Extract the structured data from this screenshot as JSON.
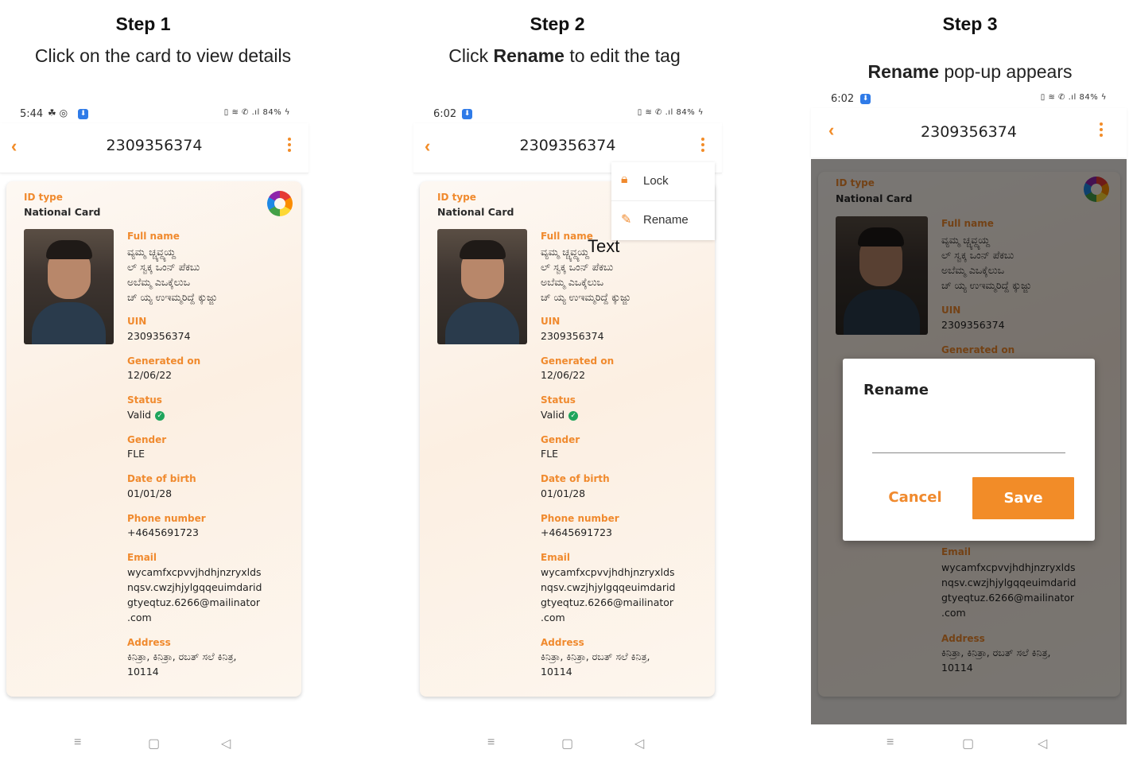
{
  "steps": [
    {
      "title": "Step 1",
      "desc": "Click on the card to view details"
    },
    {
      "title": "Step 2",
      "desc_bold": "Rename",
      "desc_pre": "Click ",
      "desc_post": " to edit the tag"
    },
    {
      "title": "Step 3",
      "desc_bold": "Rename",
      "desc_post": " pop-up appears"
    }
  ],
  "phones": [
    {
      "time": "5:44",
      "status_right": "84%"
    },
    {
      "time": "6:02",
      "status_right": "84%"
    },
    {
      "time": "6:02",
      "status_right": "84%"
    }
  ],
  "appbar": {
    "title": "2309356374"
  },
  "card": {
    "id_type_label": "ID type",
    "id_type_value": "National Card",
    "logo_text": "MOSIP",
    "fields": {
      "full_name_label": "Full name",
      "full_name_lines": [
        "ವ್ಯಮ್ಮ ಚ್ಚ್ಯವ್ದ್ಯಯ್ದ",
        "ಲ್ ಸ್ವಕ್ಕ ಒಂನ್ ಪೆಕಬು",
        "ಅಬೆಮ್ಮ ಎಒಕ್ಕೆಲುಒ",
        "ಚ್ ಯ್ಯ ಉಇಮ್ಮರಿದ್ದೆ ಕ್ಕುಜ್ಜು"
      ],
      "uin_label": "UIN",
      "uin_value": "2309356374",
      "generated_label": "Generated on",
      "generated_value": "12/06/22",
      "status_label": "Status",
      "status_value": "Valid",
      "gender_label": "Gender",
      "gender_value": "FLE",
      "dob_label": "Date of birth",
      "dob_value": "01/01/28",
      "phone_label": "Phone number",
      "phone_value": "+4645691723",
      "email_label": "Email",
      "email_lines": [
        "wycamfxcpvvjhdhjnzryxlds",
        "nqsv.cwzjhjylgqqeuimdarid",
        "gtyeqtuz.6266@mailinator",
        ".com"
      ],
      "address_label": "Address",
      "address_lines": [
        "ಕಿನಿತ್ರಾ, ಕಿನಿತ್ರಾ, ರಬತ್ ಸಲೆ ಕಿನಿತ್ರ,",
        "10114"
      ]
    }
  },
  "menu": {
    "lock": "Lock",
    "rename": "Rename",
    "annotation": "Text"
  },
  "dialog": {
    "title": "Rename",
    "cancel": "Cancel",
    "save": "Save"
  },
  "nav_icons": [
    "menu-icon",
    "home-square-icon",
    "back-triangle-icon"
  ],
  "colors": {
    "accent": "#f08a2e",
    "save_button": "#f28c28",
    "valid": "#1fa55c"
  }
}
